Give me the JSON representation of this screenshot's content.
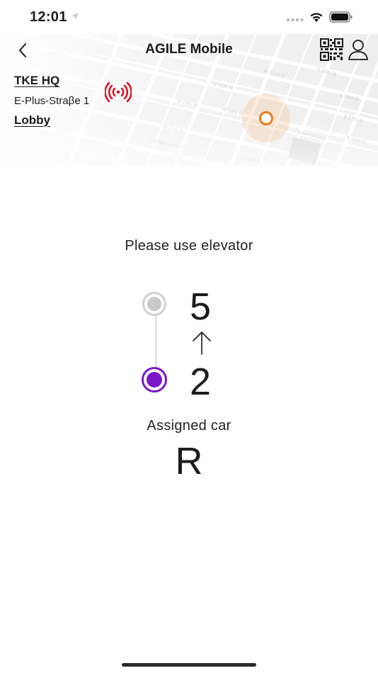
{
  "status_bar": {
    "time": "12:01",
    "icons": [
      "location-arrow-icon",
      "cellular-dots-icon",
      "wifi-icon",
      "battery-icon"
    ]
  },
  "header": {
    "title": "AGILE Mobile",
    "back_icon": "chevron-left-icon",
    "qr_icon": "qr-code-icon",
    "profile_icon": "user-icon"
  },
  "location": {
    "building": "TKE HQ",
    "street": "E-Plus-Straβe 1",
    "floor": "Lobby",
    "nfc_icon": "nfc-signal-icon",
    "nfc_color": "#e2001a"
  },
  "map": {
    "marker_color": "#ee7d1a"
  },
  "trip": {
    "instruction": "Please use elevator",
    "destination_floor": "5",
    "current_floor": "2",
    "direction": "up",
    "direction_icon": "arrow-up-icon",
    "current_color": "#7b16c8",
    "destination_color": "#c9c9c9"
  },
  "assigned": {
    "label": "Assigned car",
    "car": "R"
  }
}
